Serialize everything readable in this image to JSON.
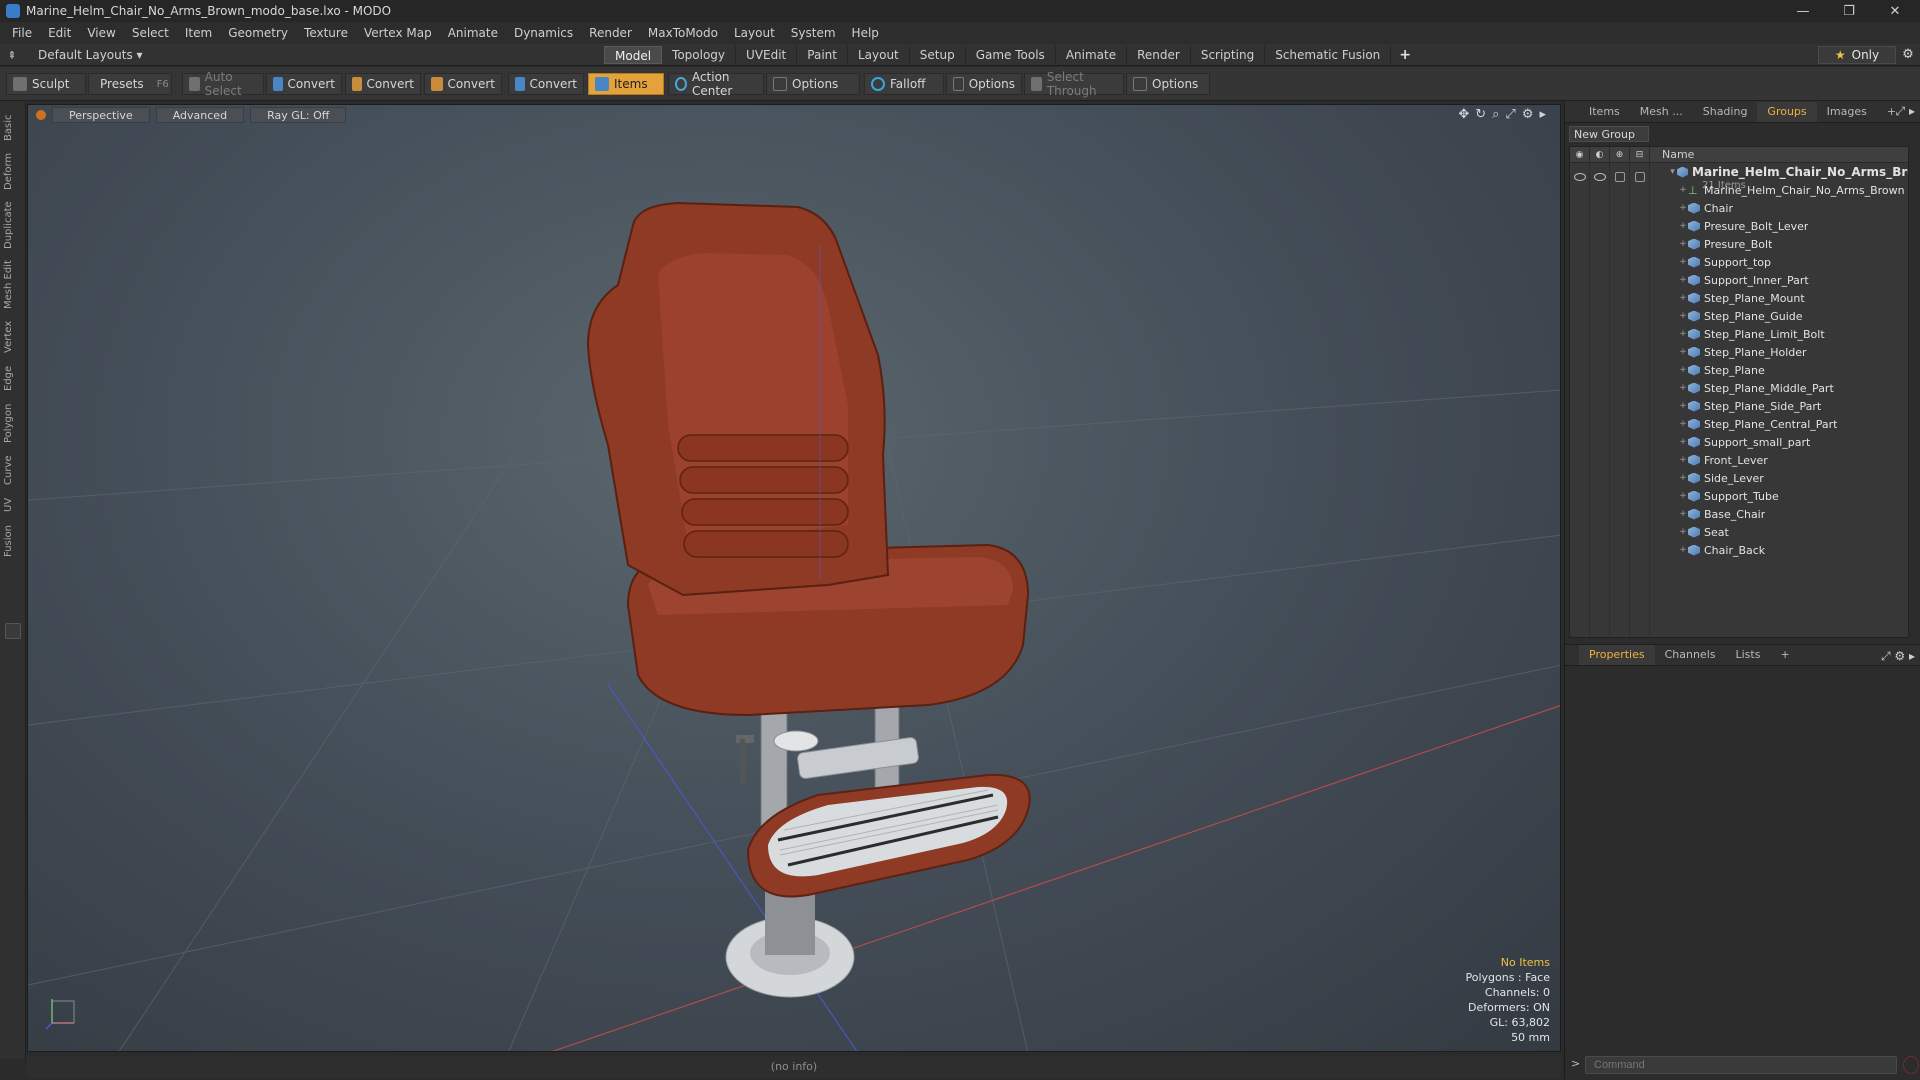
{
  "window": {
    "title": "Marine_Helm_Chair_No_Arms_Brown_modo_base.lxo - MODO",
    "controls": [
      "minimize-icon",
      "restore-icon",
      "close-icon"
    ]
  },
  "menu": [
    "File",
    "Edit",
    "View",
    "Select",
    "Item",
    "Geometry",
    "Texture",
    "Vertex Map",
    "Animate",
    "Dynamics",
    "Render",
    "MaxToModo",
    "Layout",
    "System",
    "Help"
  ],
  "layout_picker": {
    "label": "Default Layouts ▾"
  },
  "tabs": [
    "Model",
    "Topology",
    "UVEdit",
    "Paint",
    "Layout",
    "Setup",
    "Game Tools",
    "Animate",
    "Render",
    "Scripting",
    "Schematic Fusion"
  ],
  "active_tab": "Model",
  "tab_add": "+",
  "only_button": {
    "label": "Only"
  },
  "toolbar": {
    "sculpt": "Sculpt",
    "presets": "Presets",
    "presets_shortcut": "F6",
    "auto_select": "Auto Select",
    "convert1": "Convert",
    "convert2": "Convert",
    "convert3": "Convert",
    "convert4": "Convert",
    "items": "Items",
    "action_center": "Action Center",
    "options1": "Options",
    "falloff": "Falloff",
    "options2": "Options",
    "select_through": "Select Through",
    "options3": "Options"
  },
  "left_tabs": [
    "Basic",
    "Deform",
    "Duplicate",
    "Mesh Edit",
    "Vertex",
    "Edge",
    "Polygon",
    "Curve",
    "UV",
    "Fusion"
  ],
  "viewport": {
    "view": "Perspective",
    "shading": "Advanced",
    "raygl": "Ray GL: Off",
    "info": {
      "selection": "No Items",
      "polygons": "Polygons : Face",
      "channels": "Channels: 0",
      "deformers": "Deformers: ON",
      "gl": "GL: 63,802",
      "focal": "50 mm"
    }
  },
  "status": "(no info)",
  "right_panel": {
    "tabs": [
      "Items",
      "Mesh ...",
      "Shading",
      "Groups",
      "Images"
    ],
    "active_tab": "Groups",
    "tab_add": "+",
    "new_group": "New Group",
    "column_name": "Name",
    "group": {
      "name": "Marine_Helm_Chair_No_Arms_Bro...",
      "count": "21 Items",
      "items": [
        "Marine_Helm_Chair_No_Arms_Brown",
        "Chair",
        "Presure_Bolt_Lever",
        "Presure_Bolt",
        "Support_top",
        "Support_Inner_Part",
        "Step_Plane_Mount",
        "Step_Plane_Guide",
        "Step_Plane_Limit_Bolt",
        "Step_Plane_Holder",
        "Step_Plane",
        "Step_Plane_Middle_Part",
        "Step_Plane_Side_Part",
        "Step_Plane_Central_Part",
        "Support_small_part",
        "Front_Lever",
        "Side_Lever",
        "Support_Tube",
        "Base_Chair",
        "Seat",
        "Chair_Back"
      ]
    },
    "props_tabs": [
      "Properties",
      "Channels",
      "Lists"
    ],
    "props_active": "Properties",
    "props_add": "+",
    "command_placeholder": "Command"
  },
  "colors": {
    "accent": "#e4a23a",
    "chair_leather": "#8e3a24",
    "viewport_bg": "#46505a"
  }
}
